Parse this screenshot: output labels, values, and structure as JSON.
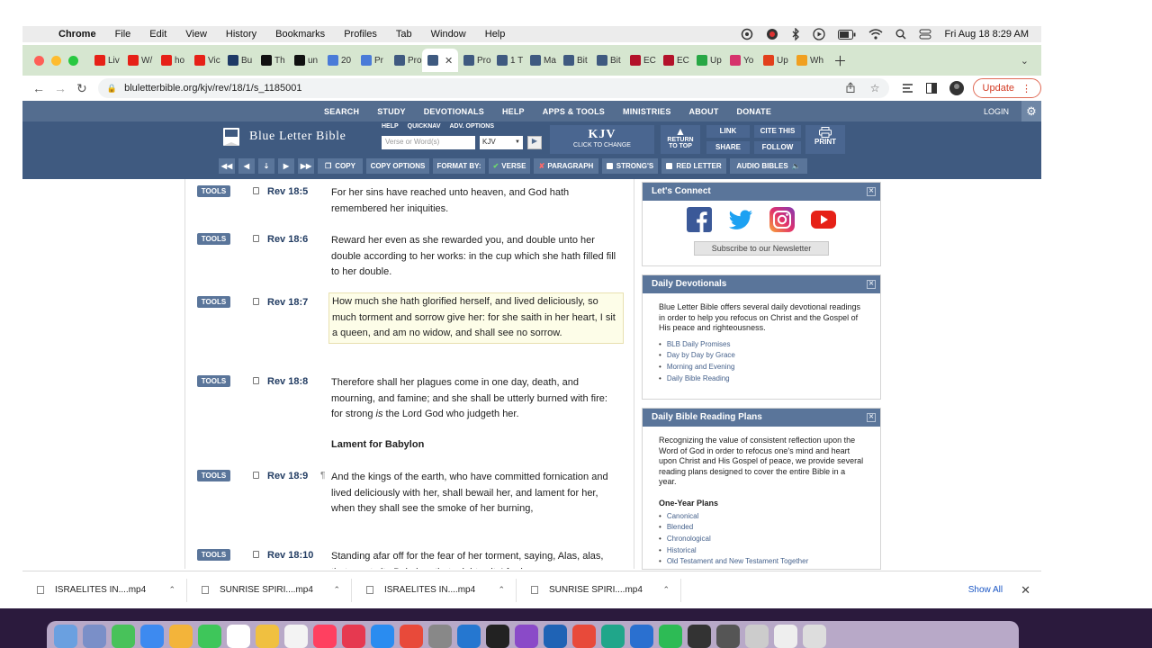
{
  "mac_menu": {
    "app": "Chrome",
    "items": [
      "File",
      "Edit",
      "View",
      "History",
      "Bookmarks",
      "Profiles",
      "Tab",
      "Window",
      "Help"
    ],
    "clock": "Fri Aug 18  8:29 AM"
  },
  "tabs": [
    {
      "label": "Liv",
      "icon": "youtube-icon",
      "color": "#e62117"
    },
    {
      "label": "W/",
      "icon": "youtube-icon",
      "color": "#e62117"
    },
    {
      "label": "ho",
      "icon": "youtube-icon",
      "color": "#e62117"
    },
    {
      "label": "Vic",
      "icon": "youtube-icon",
      "color": "#e62117"
    },
    {
      "label": "Bu",
      "icon": "bu-icon",
      "color": "#1e3a66"
    },
    {
      "label": "Th",
      "icon": "x-icon",
      "color": "#111111"
    },
    {
      "label": "un",
      "icon": "x-icon",
      "color": "#111111"
    },
    {
      "label": "20",
      "icon": "docs-icon",
      "color": "#4a7bd8"
    },
    {
      "label": "Pr",
      "icon": "google-icon",
      "color": "#4a7bd8"
    },
    {
      "label": "Pro",
      "icon": "blb-icon",
      "color": "#3f5a80"
    },
    {
      "label": "",
      "icon": "blb-icon",
      "color": "#3f5a80",
      "active": true
    },
    {
      "label": "Pro",
      "icon": "blb-icon",
      "color": "#3f5a80"
    },
    {
      "label": "1 T",
      "icon": "blb-icon",
      "color": "#3f5a80"
    },
    {
      "label": "Ma",
      "icon": "blb-icon",
      "color": "#3f5a80"
    },
    {
      "label": "Bit",
      "icon": "blb-icon",
      "color": "#3f5a80"
    },
    {
      "label": "Bit",
      "icon": "blb-icon",
      "color": "#3f5a80"
    },
    {
      "label": "EC",
      "icon": "ec-icon",
      "color": "#b3122a"
    },
    {
      "label": "EC",
      "icon": "ec-icon",
      "color": "#b3122a"
    },
    {
      "label": "Up",
      "icon": "play-icon",
      "color": "#28a745"
    },
    {
      "label": "Yo",
      "icon": "pinwheel-icon",
      "color": "#d6336c"
    },
    {
      "label": "Up",
      "icon": "refresh-icon",
      "color": "#e2401c"
    },
    {
      "label": "Wh",
      "icon": "envelope-icon",
      "color": "#f0a020"
    }
  ],
  "address": {
    "url": "bluletterbible.org/kjv/rev/18/1/s_1185001",
    "update_label": "Update"
  },
  "blb_nav": {
    "items": [
      "SEARCH",
      "STUDY",
      "DEVOTIONALS",
      "HELP",
      "APPS & TOOLS",
      "MINISTRIES",
      "ABOUT",
      "DONATE"
    ],
    "login": "LOGIN"
  },
  "header": {
    "logo_text": "Blue Letter Bible",
    "search_links": [
      "HELP",
      "QUICKNAV",
      "ADV. OPTIONS"
    ],
    "search_placeholder": "Verse or Word(s)",
    "version_selected": "KJV",
    "version_big": "KJV",
    "version_small": "CLICK TO CHANGE",
    "return_line1": "RETURN",
    "return_line2": "TO TOP",
    "link": "LINK",
    "share": "SHARE",
    "cite": "CITE THIS",
    "follow": "FOLLOW",
    "print": "PRINT"
  },
  "toolbar": {
    "copy": "COPY",
    "copy_options": "COPY OPTIONS",
    "format_by": "FORMAT BY:",
    "verse": "VERSE",
    "paragraph": "PARAGRAPH",
    "strongs": "STRONG'S",
    "red_letter": "RED LETTER",
    "audio": "AUDIO BIBLES"
  },
  "verses": [
    {
      "ref": "Rev 18:5",
      "text": "For her sins have reached unto heaven, and God hath remembered her iniquities."
    },
    {
      "ref": "Rev 18:6",
      "text": "Reward her even as she rewarded you, and double unto her double according to her works: in the cup which she hath filled fill to her double."
    },
    {
      "ref": "Rev 18:7",
      "text": "How much she hath glorified herself, and lived deliciously, so much torment and sorrow give her: for she saith in her heart, I sit a queen, and am no widow, and shall see no sorrow."
    },
    {
      "ref": "Rev 18:8",
      "text_before": "Therefore shall her plagues come in one day, death, and mourning, and famine; and she shall be utterly burned with fire: for strong ",
      "text_italic": "is",
      "text_after": " the Lord God who judgeth her."
    },
    {
      "ref": "Rev 18:9",
      "text": "And the kings of the earth, who have committed fornication and lived deliciously with her, shall bewail her, and lament for her, when they shall see the smoke of her burning,"
    },
    {
      "ref": "Rev 18:10",
      "text": "Standing afar off for the fear of her torment, saying, Alas, alas, that great city Babylon, that mighty city! for in"
    }
  ],
  "tools_label": "TOOLS",
  "section_heading": "Lament for Babylon",
  "paragraph_mark": "¶",
  "sidebar": {
    "connect_title": "Let's Connect",
    "newsletter": "Subscribe to our Newsletter",
    "devotionals_title": "Daily Devotionals",
    "devotionals_text": "Blue Letter Bible offers several daily devotional readings in order to help you refocus on Christ and the Gospel of His peace and righteousness.",
    "devotionals_links": [
      "BLB Daily Promises",
      "Day by Day by Grace",
      "Morning and Evening",
      "Daily Bible Reading"
    ],
    "plans_title": "Daily Bible Reading Plans",
    "plans_text": "Recognizing the value of consistent reflection upon the Word of God in order to refocus one's mind and heart upon Christ and His Gospel of peace, we provide several reading plans designed to cover the entire Bible in a year.",
    "plans_subtitle": "One-Year Plans",
    "plans_links": [
      "Canonical",
      "Blended",
      "Chronological",
      "Historical",
      "Old Testament and New Testament Together"
    ]
  },
  "downloads": {
    "files": [
      "ISRAELITES IN....mp4",
      "SUNRISE SPIRI....mp4",
      "ISRAELITES IN....mp4",
      "SUNRISE SPIRI....mp4"
    ],
    "show_all": "Show All"
  },
  "dock_colors": [
    "#6aa0e0",
    "#7a8fc8",
    "#48c25a",
    "#3d8af0",
    "#f3b43a",
    "#3ec65a",
    "#ffffff",
    "#f0c040",
    "#f3f3f3",
    "#ff4060",
    "#e63950",
    "#2a8cf0",
    "#e84a3a",
    "#888888",
    "#2577d0",
    "#222222",
    "#8a4ac8",
    "#1f63b5",
    "#e84a3a",
    "#20a68a",
    "#2a70d0",
    "#2dbb55",
    "#333333",
    "#555555",
    "#cccccc",
    "#eeeeee",
    "#dddddd"
  ]
}
